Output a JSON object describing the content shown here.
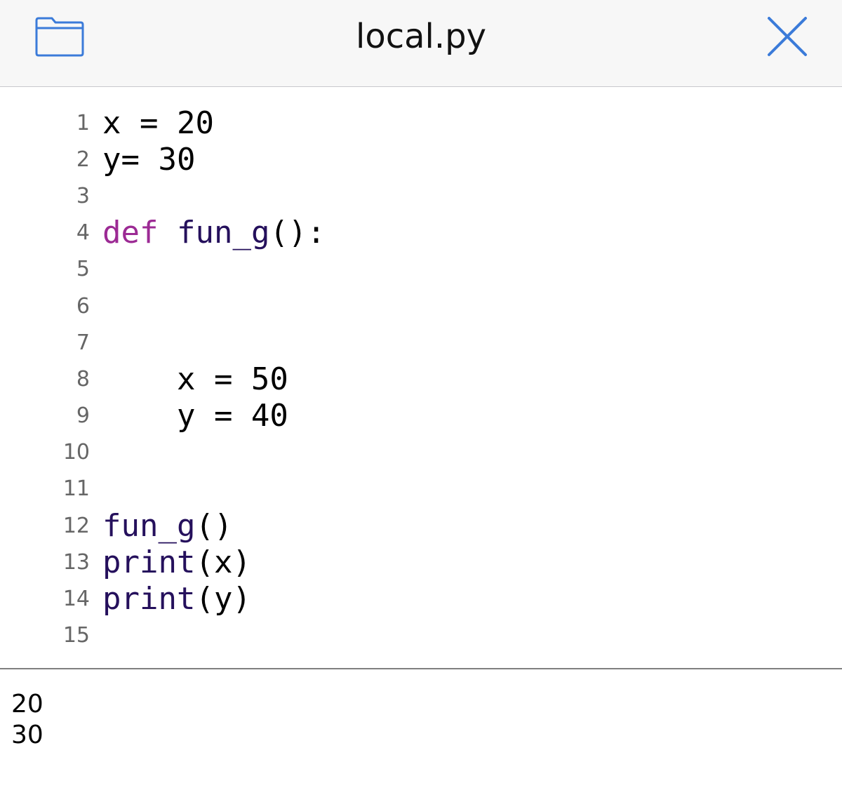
{
  "header": {
    "title": "local.py",
    "folder_icon": "folder-icon",
    "close_icon": "close-icon",
    "accent_color": "#3b7bd9"
  },
  "editor": {
    "lines": [
      {
        "number": "1",
        "tokens": [
          {
            "text": "x = 20",
            "kind": "plain"
          }
        ]
      },
      {
        "number": "2",
        "tokens": [
          {
            "text": "y= 30",
            "kind": "plain"
          }
        ]
      },
      {
        "number": "3",
        "tokens": []
      },
      {
        "number": "4",
        "tokens": [
          {
            "text": "def",
            "kind": "kw"
          },
          {
            "text": " ",
            "kind": "plain"
          },
          {
            "text": "fun_g",
            "kind": "fn"
          },
          {
            "text": "():",
            "kind": "plain"
          }
        ]
      },
      {
        "number": "5",
        "tokens": []
      },
      {
        "number": "6",
        "tokens": []
      },
      {
        "number": "7",
        "tokens": []
      },
      {
        "number": "8",
        "tokens": [
          {
            "text": "    x = 50",
            "kind": "plain"
          }
        ]
      },
      {
        "number": "9",
        "tokens": [
          {
            "text": "    y = 40",
            "kind": "plain"
          }
        ]
      },
      {
        "number": "10",
        "tokens": []
      },
      {
        "number": "11",
        "tokens": []
      },
      {
        "number": "12",
        "tokens": [
          {
            "text": "fun_g",
            "kind": "fn"
          },
          {
            "text": "()",
            "kind": "plain"
          }
        ]
      },
      {
        "number": "13",
        "tokens": [
          {
            "text": "print",
            "kind": "fn"
          },
          {
            "text": "(x)",
            "kind": "plain"
          }
        ]
      },
      {
        "number": "14",
        "tokens": [
          {
            "text": "print",
            "kind": "fn"
          },
          {
            "text": "(y)",
            "kind": "plain"
          }
        ]
      },
      {
        "number": "15",
        "tokens": []
      }
    ],
    "colors": {
      "keyword": "#9c2a94",
      "function": "#25105c",
      "plain": "#000000",
      "line_number": "#666666"
    }
  },
  "console": {
    "output": [
      "20",
      "30"
    ]
  }
}
